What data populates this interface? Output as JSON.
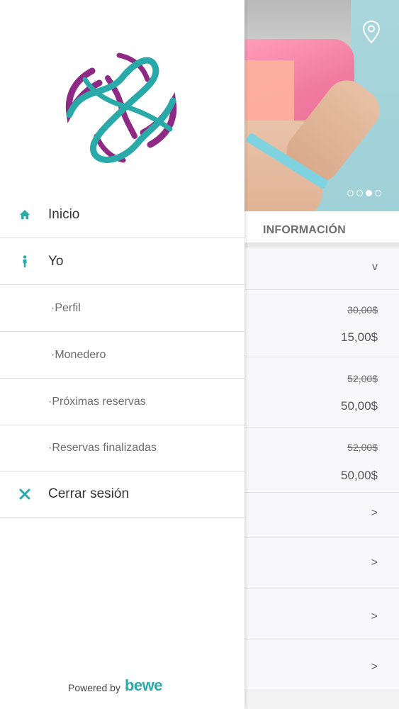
{
  "background": {
    "section_title": "INFORMACIÓN",
    "carousel": {
      "slides": 4,
      "active_index": 2
    },
    "rows": [
      {
        "type": "collapse",
        "chevron": "v"
      },
      {
        "type": "price",
        "old_price": "30,00$",
        "new_price": "15,00$"
      },
      {
        "type": "price",
        "old_price": "52,00$",
        "new_price": "50,00$"
      },
      {
        "type": "price",
        "old_price": "52,00$",
        "new_price": "50,00$"
      },
      {
        "type": "link",
        "chevron": ">"
      },
      {
        "type": "link",
        "chevron": ">"
      },
      {
        "type": "link",
        "chevron": ">"
      },
      {
        "type": "link",
        "chevron": ">"
      }
    ]
  },
  "drawer": {
    "menu": [
      {
        "label": "Inicio",
        "icon": "home-icon"
      },
      {
        "label": "Yo",
        "icon": "person-icon"
      },
      {
        "label": "·Perfil"
      },
      {
        "label": "·Monedero"
      },
      {
        "label": "·Próximas reservas"
      },
      {
        "label": "·Reservas finalizadas"
      },
      {
        "label": "Cerrar sesión",
        "icon": "close-icon"
      }
    ],
    "footer": {
      "powered_by": "Powered by",
      "brand": "bewe"
    }
  },
  "colors": {
    "accent": "#2aa9a9",
    "logo_purple": "#8e2a83",
    "logo_teal": "#2aa9a9"
  }
}
